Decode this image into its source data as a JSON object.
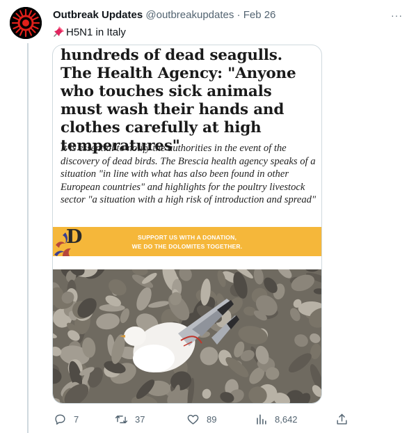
{
  "tweet": {
    "author_name": "Outbreak Updates",
    "author_handle": "@outbreakupdates",
    "separator": "·",
    "date": "Feb 26",
    "more_label": "···",
    "text": "H5N1 in Italy",
    "icons": {
      "avatar": "virus-logo",
      "pin": "pushpin-emoji",
      "more": "more-icon"
    }
  },
  "article": {
    "headline": "hundreds of dead seagulls. The Health Agency: \"Anyone who touches sick animals must wash their hands and clothes carefully at high temperatures\"",
    "subtext": "It is essential to notify the authorities in the event of the discovery of dead birds. The Brescia health agency speaks of a situation \"in line with what has also been found in other European countries\" and highlights for the poultry livestock sector \"a situation with a high risk of introduction and spread\"",
    "banner": {
      "line1": "SUPPORT US WITH A DONATION,",
      "line2": "WE DO THE DOLOMITES TOGETHER.",
      "logo_letter": "D",
      "color": "#f5b73a"
    }
  },
  "actions": {
    "reply_count": "7",
    "retweet_count": "37",
    "like_count": "89",
    "views_count": "8,642",
    "icons": [
      "reply-icon",
      "retweet-icon",
      "like-icon",
      "views-icon",
      "share-icon"
    ]
  }
}
